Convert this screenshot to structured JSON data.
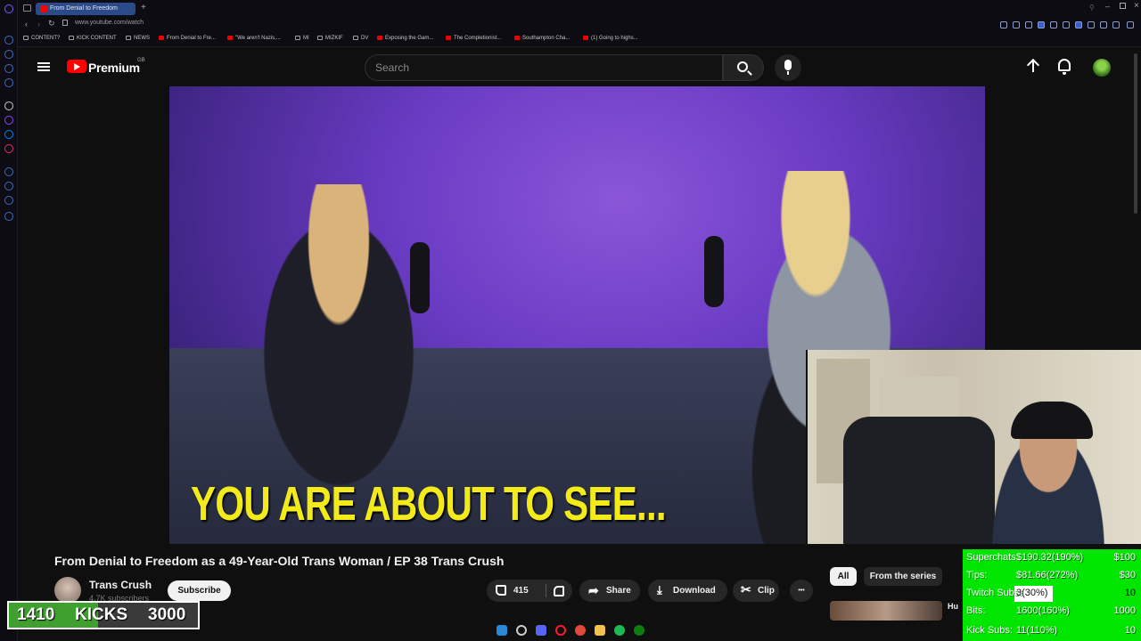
{
  "browser": {
    "active_tab": "From Denial to Freedom",
    "url": "www.youtube.com/watch",
    "bookmarks": [
      "CONTENT?",
      "KICK CONTENT",
      "NEWS",
      "From Denial to Fre...",
      "\"We aren't Nazis,...",
      "MI",
      "MIZKIF",
      "DV",
      "Exposing the Gam...",
      "The Completionist...",
      "Southampton Cha...",
      "(1) Going to highs..."
    ]
  },
  "youtube": {
    "wordmark": "Premium",
    "region": "GB",
    "search_placeholder": "Search"
  },
  "video": {
    "caption": "YOU ARE ABOUT TO SEE...",
    "title": "From Denial to Freedom as a 49-Year-Old Trans Woman / EP 38 Trans Crush",
    "channel": "Trans Crush",
    "subscribers": "4.7K subscribers",
    "subscribe_label": "Subscribe",
    "likes": "415",
    "share_label": "Share",
    "download_label": "Download",
    "clip_label": "Clip",
    "more_label": "•••"
  },
  "side": {
    "chips": [
      "All",
      "From the series"
    ],
    "related_title": "Hu"
  },
  "kicks": {
    "current": "1410",
    "label": "KICKS",
    "goal": "3000",
    "progress": 0.47
  },
  "goals": [
    {
      "label": "Superchats:",
      "value": "$190.32(190%)",
      "target": "$100",
      "progress": 1.0
    },
    {
      "label": "Tips:",
      "value": "$81.66(272%)",
      "target": "$30",
      "progress": 1.0
    },
    {
      "label": "Twitch Subs:",
      "value": "3(30%)",
      "target": "10",
      "progress": 0.3
    },
    {
      "label": "Bits:",
      "value": "1600(160%)",
      "target": "1000",
      "progress": 1.0
    },
    {
      "label": "Kick Subs:",
      "value": "11(110%)",
      "target": "10",
      "progress": 1.0
    }
  ],
  "colors": {
    "yt_red": "#ff0000",
    "caption_yellow": "#f3ea1a",
    "goal_green": "#00e600",
    "kicks_green": "#3f9f2f"
  }
}
